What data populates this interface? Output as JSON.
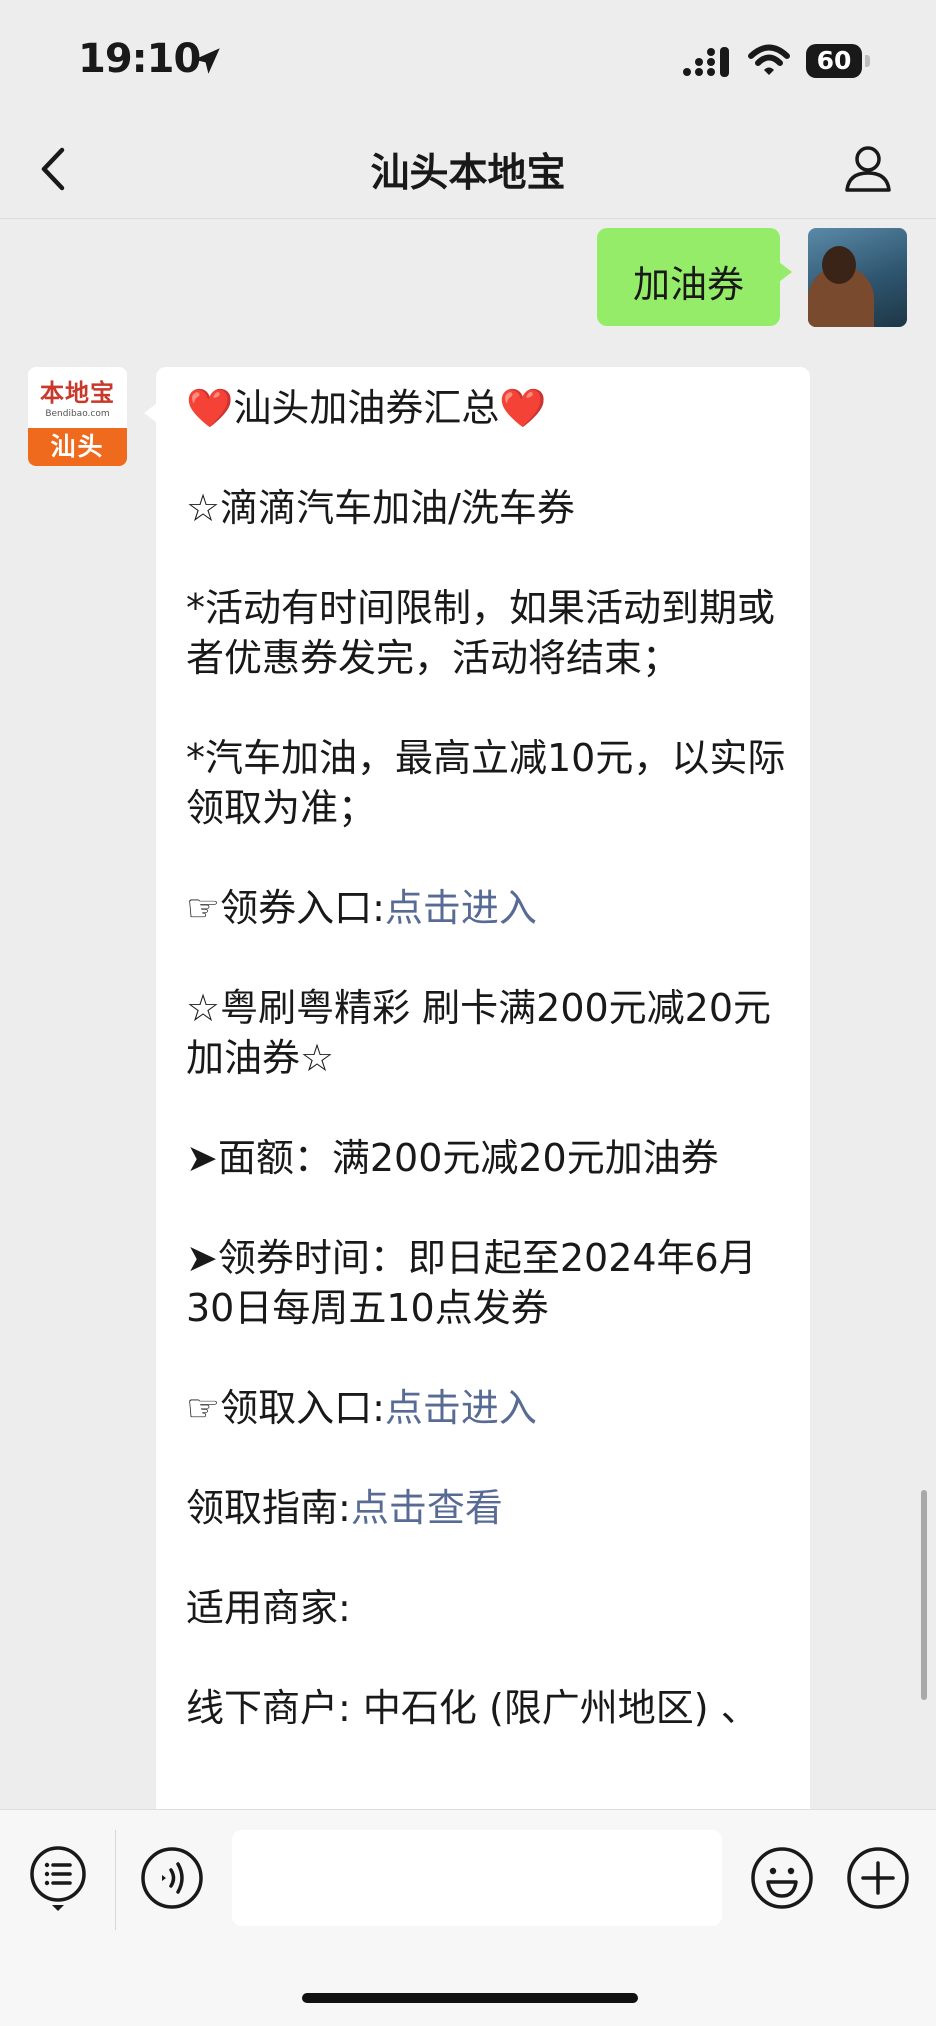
{
  "status_bar": {
    "time": "19:10",
    "battery": "60"
  },
  "nav": {
    "title": "汕头本地宝"
  },
  "my_message": {
    "text": "加油券"
  },
  "bot": {
    "logo_main": "本地宝",
    "logo_sub": "Bendibao.com",
    "logo_city": "汕头"
  },
  "message": {
    "title_heart_left": "❤️",
    "title": "汕头加油券汇总",
    "title_heart_right": "❤️",
    "section1": "☆滴滴汽车加油/洗车券",
    "note1": "*活动有时间限制，如果活动到期或者优惠券发完，活动将结束；",
    "note2": "*汽车加油，最高立减10元，以实际领取为准；",
    "entry1_prefix": "☞领券入口:",
    "entry1_link": "点击进入",
    "section2": "☆粤刷粤精彩 刷卡满200元减20元加油券☆",
    "face_value": "➤面额：满200元减20元加油券",
    "claim_time": "➤领券时间：即日起至2024年6月30日每周五10点发券",
    "entry2_prefix": "☞领取入口:",
    "entry2_link": "点击进入",
    "guide_prefix": "领取指南:",
    "guide_link": "点击查看",
    "merchants_label": "适用商家:",
    "offline_merchants": "线下商户: 中石化 (限广州地区) 、"
  },
  "input_bar": {
    "placeholder": ""
  }
}
